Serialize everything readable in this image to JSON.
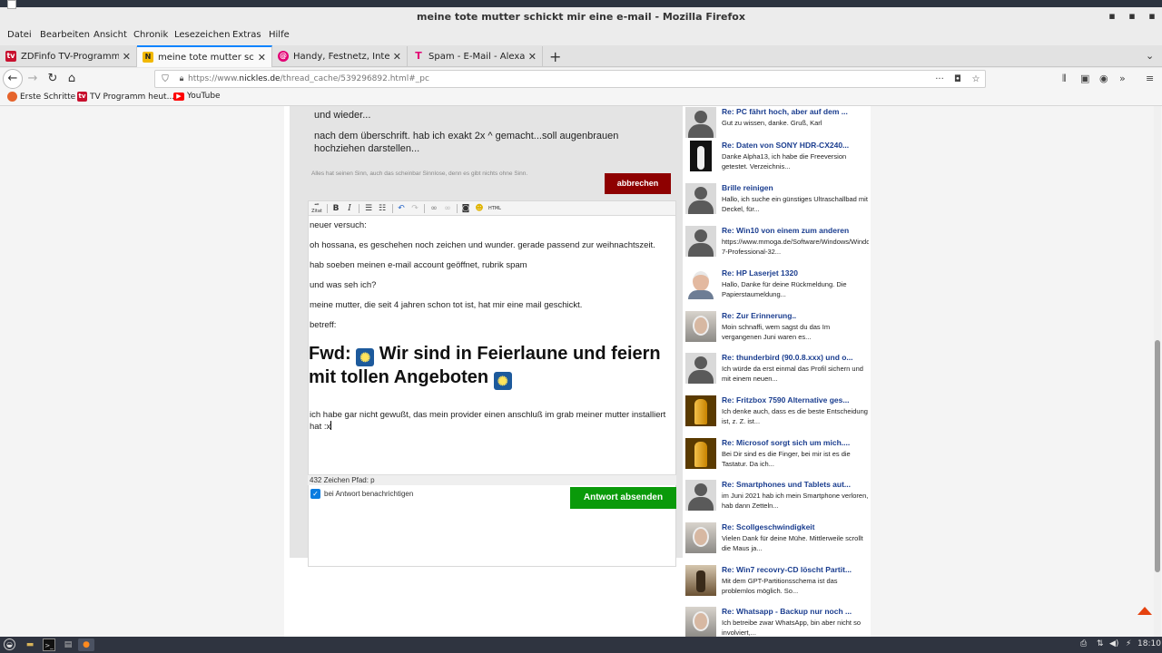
{
  "window": {
    "title": "meine tote mutter schickt mir eine e-mail - Mozilla Firefox",
    "controls": [
      "minimize-icon",
      "maximize-icon",
      "close-icon"
    ]
  },
  "menu": [
    "Datei",
    "Bearbeiten",
    "Ansicht",
    "Chronik",
    "Lesezeichen",
    "Extras",
    "Hilfe"
  ],
  "tabs": [
    {
      "label": "ZDFinfo TV-Programm: Ach",
      "favicon": "tv",
      "color": "#c8102e"
    },
    {
      "label": "meine tote mutter schickt",
      "favicon": "N",
      "color": "#f2b800"
    },
    {
      "label": "Handy, Festnetz, Internet, ",
      "favicon": "@",
      "color": "#e20074"
    },
    {
      "label": "Spam - E-Mail - Alexander",
      "favicon": "T",
      "color": "#e20074"
    }
  ],
  "newtab_label": "+",
  "nav": {
    "url_prefix": "https://www.",
    "url_domain": "nickles.de",
    "url_rest": "/thread_cache/539296892.html#_pc",
    "more": "···"
  },
  "bookmarks": [
    {
      "label": "Erste Schritte",
      "icon": "firefox-icon"
    },
    {
      "label": "TV Programm heut...",
      "icon": "tv"
    },
    {
      "label": "YouTube",
      "icon": "youtube-icon"
    }
  ],
  "post": {
    "line_top": "und wieder...",
    "line2": "nach dem überschrift. hab ich exakt 2x ^ gemacht...soll augenbrauen hochziehen darstellen...",
    "signature": "Alles hat seinen Sinn, auch das scheinbar Sinnlose, denn es gibt nichts ohne Sinn.",
    "cancel_label": "abbrechen"
  },
  "editor": {
    "toolbar_zitat": "Zitat",
    "toolbar_html": "HTML",
    "lines": [
      "neuer versuch:",
      "oh hossana, es geschehen noch zeichen und wunder. gerade passend zur weihnachtszeit.",
      "hab soeben meinen e-mail account geöffnet, rubrik spam",
      "und was seh ich?",
      "meine mutter, die seit 4 jahren schon tot ist, hat mir eine mail geschickt.",
      "betreff:"
    ],
    "heading_part1": "Fwd: ",
    "heading_part2": " Wir sind in Feierlaune und feiern mit tollen Angeboten ",
    "last_line": "ich habe gar nicht gewußt, das mein provider einen anschluß im grab meiner mutter installiert hat :x",
    "status": "432 Zeichen Pfad: p",
    "notify_label": "bei Antwort benachrichtigen",
    "send_label": "Antwort absenden"
  },
  "threads": [
    {
      "title": "Re: PC fährt hoch, aber auf dem ...",
      "desc": "Gut zu wissen, danke. Gruß, Karl",
      "avatar": "silhouette"
    },
    {
      "title": "Re: Daten von SONY HDR-CX240...",
      "desc": "Danke Alpha13, ich habe die Freeversion getestet. Verzeichnis...",
      "avatar": "dark"
    },
    {
      "title": "Brille reinigen",
      "desc": "Hallo, ich suche ein günstiges Ultraschallbad mit Deckel, für...",
      "avatar": "silhouette"
    },
    {
      "title": "Re: Win10 von einem zum anderen",
      "desc": "https://www.mmoga.de/Software/Windows/Windows-7-Professional-32...",
      "avatar": "silhouette"
    },
    {
      "title": "Re: HP Laserjet 1320",
      "desc": "Hallo, Danke für deine Rückmeldung. Die Papierstaumeldung...",
      "avatar": "hp"
    },
    {
      "title": "Re: Zur Erinnerung..",
      "desc": "Moin schnaffi, wem sagst du das Im vergangenen Juni waren es...",
      "avatar": "old"
    },
    {
      "title": "Re: thunderbird (90.0.8.xxx) und o...",
      "desc": "Ich würde da erst einmal das Profil sichern und mit einem neuen...",
      "avatar": "silhouette"
    },
    {
      "title": "Re: Fritzbox 7590 Alternative ges...",
      "desc": "Ich denke auch, dass es die beste Entscheidung ist, z. Z. ist...",
      "avatar": "gold"
    },
    {
      "title": "Re: Microsof sorgt sich um mich....",
      "desc": "Bei Dir sind es die Finger, bei mir ist es die Tastatur. Da ich...",
      "avatar": "gold"
    },
    {
      "title": "Re: Smartphones und Tablets aut...",
      "desc": "im Juni 2021 hab ich mein Smartphone verloren, hab dann Zetteln...",
      "avatar": "silhouette"
    },
    {
      "title": "Re: Scollgeschwindigkeit",
      "desc": "Vielen Dank für deine Mühe. Mittlerweile scrollt die Maus ja...",
      "avatar": "old"
    },
    {
      "title": "Re: Win7 recovry-CD löscht Partit...",
      "desc": "Mit dem GPT-Partitionsschema ist das problemlos möglich. So...",
      "avatar": "bike"
    },
    {
      "title": "Re: Whatsapp - Backup nur noch ...",
      "desc": "Ich betreibe zwar WhatsApp, bin aber nicht so involviert,...",
      "avatar": "old"
    }
  ],
  "taskbar": {
    "clock": "18:10"
  }
}
